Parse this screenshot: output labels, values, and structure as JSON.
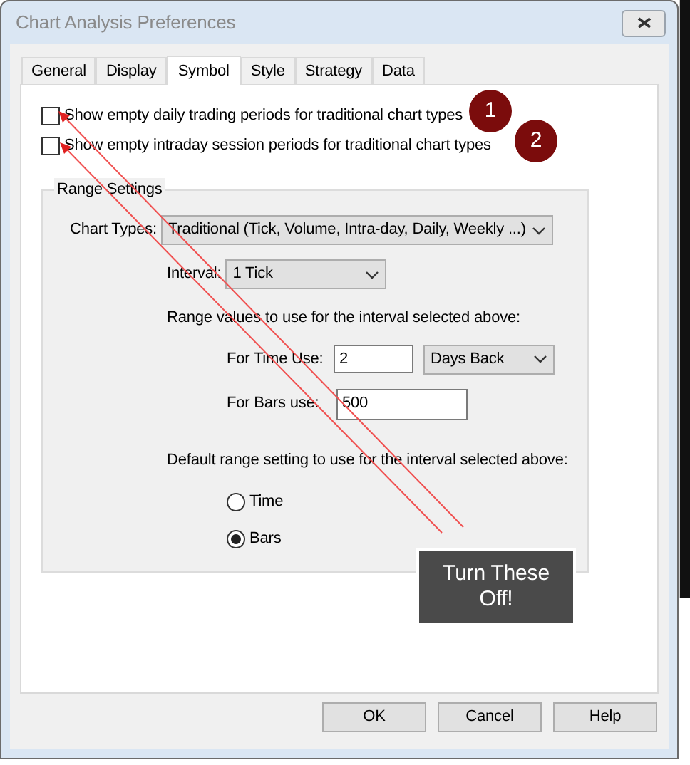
{
  "window": {
    "title": "Chart Analysis Preferences"
  },
  "tabs": [
    {
      "label": "General",
      "selected": false
    },
    {
      "label": "Display",
      "selected": false
    },
    {
      "label": "Symbol",
      "selected": true
    },
    {
      "label": "Style",
      "selected": false
    },
    {
      "label": "Strategy",
      "selected": false
    },
    {
      "label": "Data",
      "selected": false
    }
  ],
  "options": [
    {
      "label": "Show empty daily trading periods for traditional chart types",
      "checked": false
    },
    {
      "label": "Show empty intraday session periods for traditional chart types",
      "checked": false
    }
  ],
  "range_settings": {
    "title": "Range Settings",
    "chart_types": {
      "label": "Chart Types:",
      "value": "Traditional (Tick, Volume, Intra-day, Daily, Weekly ...)"
    },
    "interval": {
      "label": "Interval:",
      "value": "1 Tick"
    },
    "range_heading": "Range values to use for the interval selected above:",
    "time_use": {
      "label": "For Time Use:",
      "value": "2",
      "unit": "Days Back"
    },
    "bars_use": {
      "label": "For Bars use:",
      "value": "500"
    },
    "default_heading": "Default range setting to use for the interval selected above:",
    "radios": [
      {
        "label": "Time",
        "selected": false
      },
      {
        "label": "Bars",
        "selected": true
      }
    ]
  },
  "buttons": [
    "OK",
    "Cancel",
    "Help"
  ],
  "annotations": {
    "markers": [
      "1",
      "2"
    ],
    "callout": "Turn These Off!"
  }
}
